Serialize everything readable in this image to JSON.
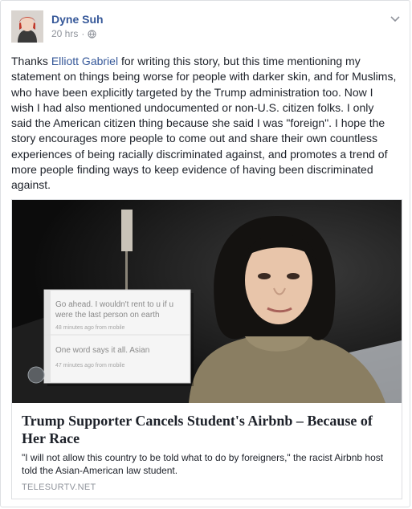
{
  "post": {
    "author": "Dyne Suh",
    "timestamp": "20 hrs",
    "separator": "·",
    "privacy_icon": "globe-icon",
    "menu_icon": "chevron-down-icon",
    "text_before_link": "Thanks ",
    "link_text": "Elliott Gabriel",
    "text_after_link": " for writing this story, but this time mentioning my statement on things being worse for people with darker skin, and for Muslims, who have been explicitly targeted by the Trump administration too. Now I wish I had also mentioned undocumented or non-U.S. citizen folks. I only said the American citizen thing because she said I was \"foreign\". I hope the story encourages more people to come out and share their own countless experiences of being racially discriminated against, and promotes a trend of more people finding ways to keep evidence of having been discriminated against."
  },
  "attachment": {
    "title": "Trump Supporter Cancels Student's Airbnb – Because of Her Race",
    "description": "\"I will not allow this country to be told what to do by foreigners,\" the racist Airbnb host told the Asian-American law student.",
    "domain": "TELESURTV.NET",
    "image": {
      "message_1": "Go ahead. I wouldn't rent to u if u were the last person on earth",
      "meta_1": "48 minutes ago from mobile",
      "message_2": "One word says it all. Asian",
      "meta_2": "47 minutes ago from mobile"
    }
  },
  "colors": {
    "link": "#365899",
    "meta": "#90949c",
    "border": "#dddfe2"
  }
}
